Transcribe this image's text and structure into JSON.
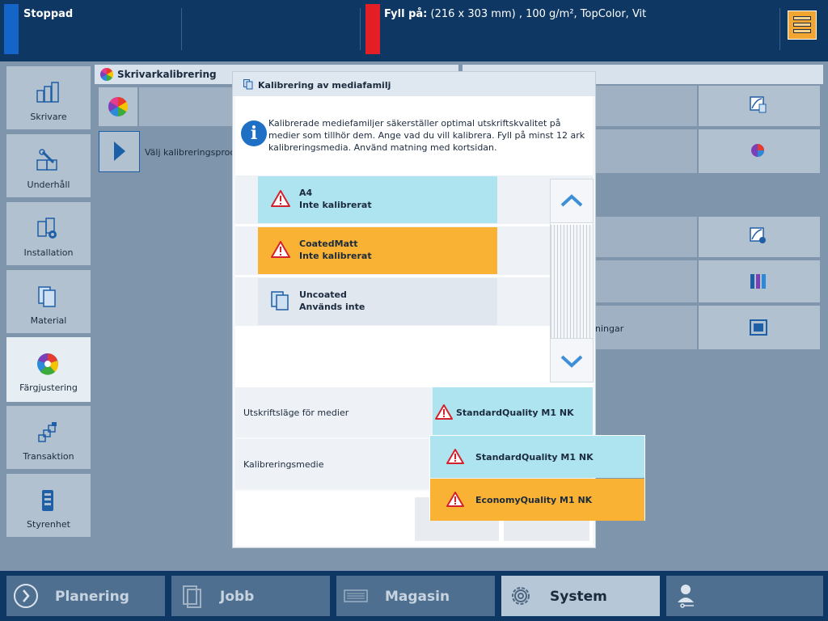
{
  "status": {
    "text": "Stoppad"
  },
  "fill": {
    "label": "Fyll på:",
    "value": "(216 x 303 mm) , 100 g/m², TopColor, Vit"
  },
  "colors": {
    "accent_cyan": "#aee4ef",
    "warning_orange": "#f9b233",
    "status_blue": "#1565c8",
    "fill_red": "#e31e24"
  },
  "sidebar": {
    "items": [
      {
        "label": "Skrivare",
        "icon": "printer-icon"
      },
      {
        "label": "Underhåll",
        "icon": "wrench-icon"
      },
      {
        "label": "Installation",
        "icon": "gear-install-icon"
      },
      {
        "label": "Material",
        "icon": "media-icon"
      },
      {
        "label": "Färgjustering",
        "icon": "color-wheel-icon",
        "active": true
      },
      {
        "label": "Transaktion",
        "icon": "transaction-icon"
      },
      {
        "label": "Styrenhet",
        "icon": "controller-icon"
      }
    ]
  },
  "workspace": {
    "panel_title": "Skrivarkalibrering",
    "choose_text": "Välj kalibreringsprocedu",
    "right_text": "ningar"
  },
  "modal": {
    "title": "Kalibrering av mediafamilj",
    "info": "Kalibrerade mediefamiljer säkerställer optimal utskriftskvalitet på medier som tillhör dem. Ange vad du vill kalibrera. Fyll på minst 12 ark kalibreringsmedia. Använd matning med kortsidan.",
    "media": [
      {
        "name": "A4",
        "status": "Inte kalibrerat",
        "state": "cyan"
      },
      {
        "name": "CoatedMatt",
        "status": "Inte kalibrerat",
        "state": "orange"
      },
      {
        "name": "Uncoated",
        "status": "Används inte",
        "state": "grey"
      }
    ],
    "print_mode": {
      "label": "Utskriftsläge för medier",
      "value": "StandardQuality M1 NK"
    },
    "calibration_media": {
      "label": "Kalibreringsmedie"
    }
  },
  "dropdown": {
    "options": [
      {
        "label": "StandardQuality M1 NK"
      },
      {
        "label": "EconomyQuality M1 NK"
      }
    ]
  },
  "bottom_nav": {
    "items": [
      {
        "label": "Planering"
      },
      {
        "label": "Jobb"
      },
      {
        "label": "Magasin"
      },
      {
        "label": "System",
        "active": true
      }
    ]
  }
}
